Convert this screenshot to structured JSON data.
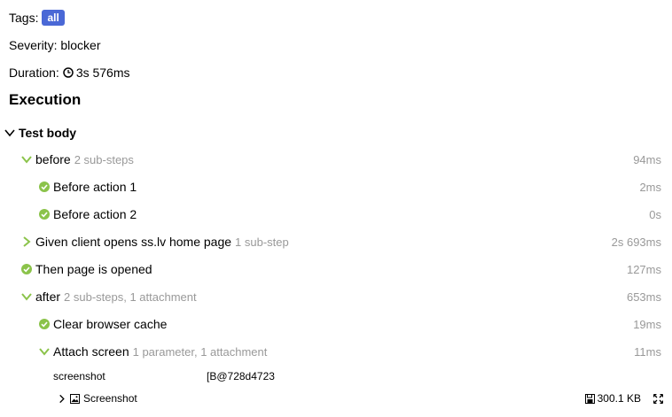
{
  "meta": {
    "tags_label": "Tags:",
    "tag_badge": "all",
    "severity_label": "Severity: blocker",
    "duration_label": "Duration:",
    "duration_value": "3s 576ms"
  },
  "execution": {
    "heading": "Execution",
    "test_body": "Test body",
    "steps": [
      {
        "title": "before",
        "sub": "2 sub-steps",
        "duration": "94ms"
      },
      {
        "title": "Before action 1",
        "duration": "2ms"
      },
      {
        "title": "Before action 2",
        "duration": "0s"
      },
      {
        "title": "Given client opens ss.lv home page",
        "sub": "1 sub-step",
        "duration": "2s 693ms"
      },
      {
        "title": "Then page is opened",
        "duration": "127ms"
      },
      {
        "title": "after",
        "sub": "2 sub-steps, 1 attachment",
        "duration": "653ms"
      },
      {
        "title": "Clear browser cache",
        "duration": "19ms"
      },
      {
        "title": "Attach screen",
        "sub": "1 parameter, 1 attachment",
        "duration": "11ms"
      }
    ],
    "parameter": {
      "name": "screenshot",
      "value": "[B@728d4723"
    },
    "attachment": {
      "name": "Screenshot",
      "size": "300.1 KB"
    }
  },
  "colors": {
    "accent": "#4a68d6",
    "check": "#8bc34a",
    "muted": "#999999"
  }
}
